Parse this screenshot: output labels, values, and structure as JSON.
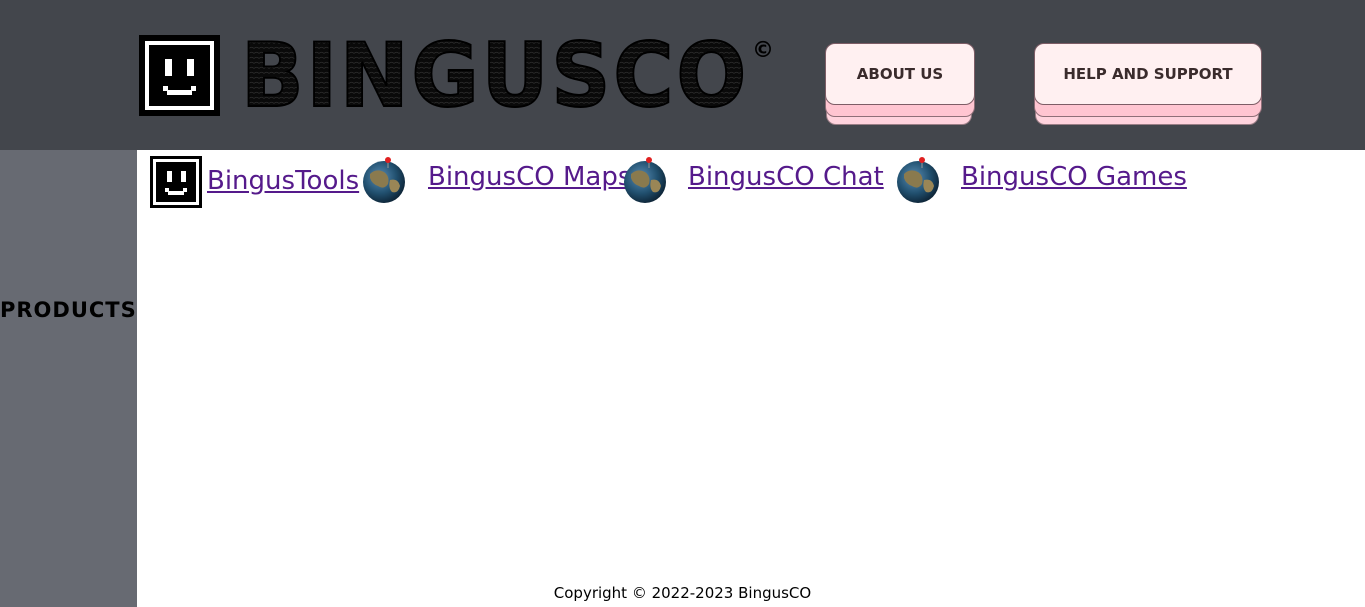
{
  "header": {
    "brand": "BINGUSCO",
    "trademark": "©",
    "nav": {
      "about_label": "ABOUT US",
      "help_label": "HELP AND SUPPORT"
    }
  },
  "sidebar": {
    "label": "PRODUCTS"
  },
  "products": [
    {
      "label": "BingusTools",
      "icon": "bingus-face-icon"
    },
    {
      "label": "BingusCO Maps",
      "icon": "globe-icon"
    },
    {
      "label": "BingusCO Chat",
      "icon": "globe-icon"
    },
    {
      "label": "BingusCO Games",
      "icon": "globe-icon"
    }
  ],
  "footer": {
    "copyright": "Copyright © 2022-2023 BingusCO"
  },
  "colors": {
    "header_bg": "#43464c",
    "sidebar_bg": "#676a72",
    "button_bg": "#fff0f1",
    "button_shadow": "#ffc5d1",
    "link": "#551a8b"
  }
}
